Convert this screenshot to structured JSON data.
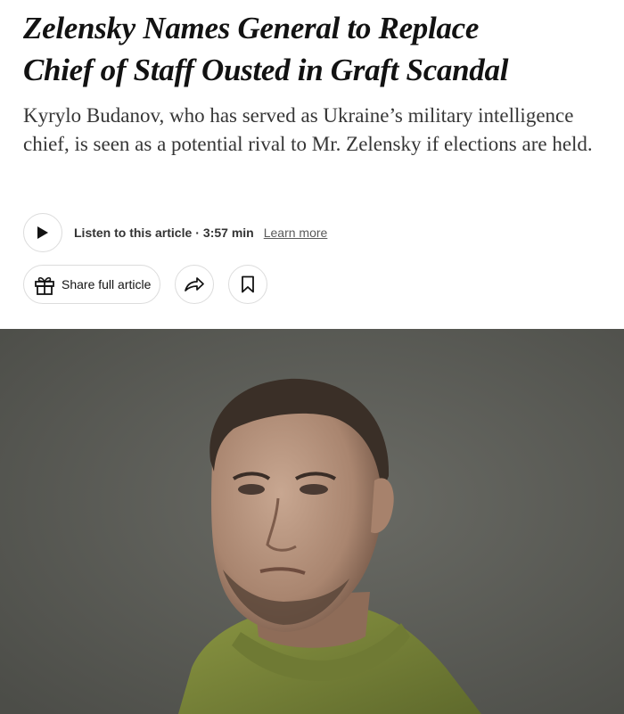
{
  "article": {
    "headline_line1": "Zelensky Names General to Replace",
    "headline_line2": "Chief of Staff Ousted in Graft Scandal",
    "summary": "Kyrylo Budanov, who has served as Ukraine’s military intelligence chief, is seen as a potential rival to Mr. Zelensky if elections are held."
  },
  "audio": {
    "play_icon": "play-icon",
    "listen_label": "Listen to this article",
    "separator": "·",
    "duration": "3:57 min",
    "learn_more": "Learn more"
  },
  "actions": {
    "share_full_article": "Share full article",
    "gift_icon": "gift-icon",
    "share_icon": "share-arrow-icon",
    "bookmark_icon": "bookmark-icon"
  },
  "photo": {
    "background_color": "#5f605a",
    "jacket_color": "#7f8a3a"
  }
}
